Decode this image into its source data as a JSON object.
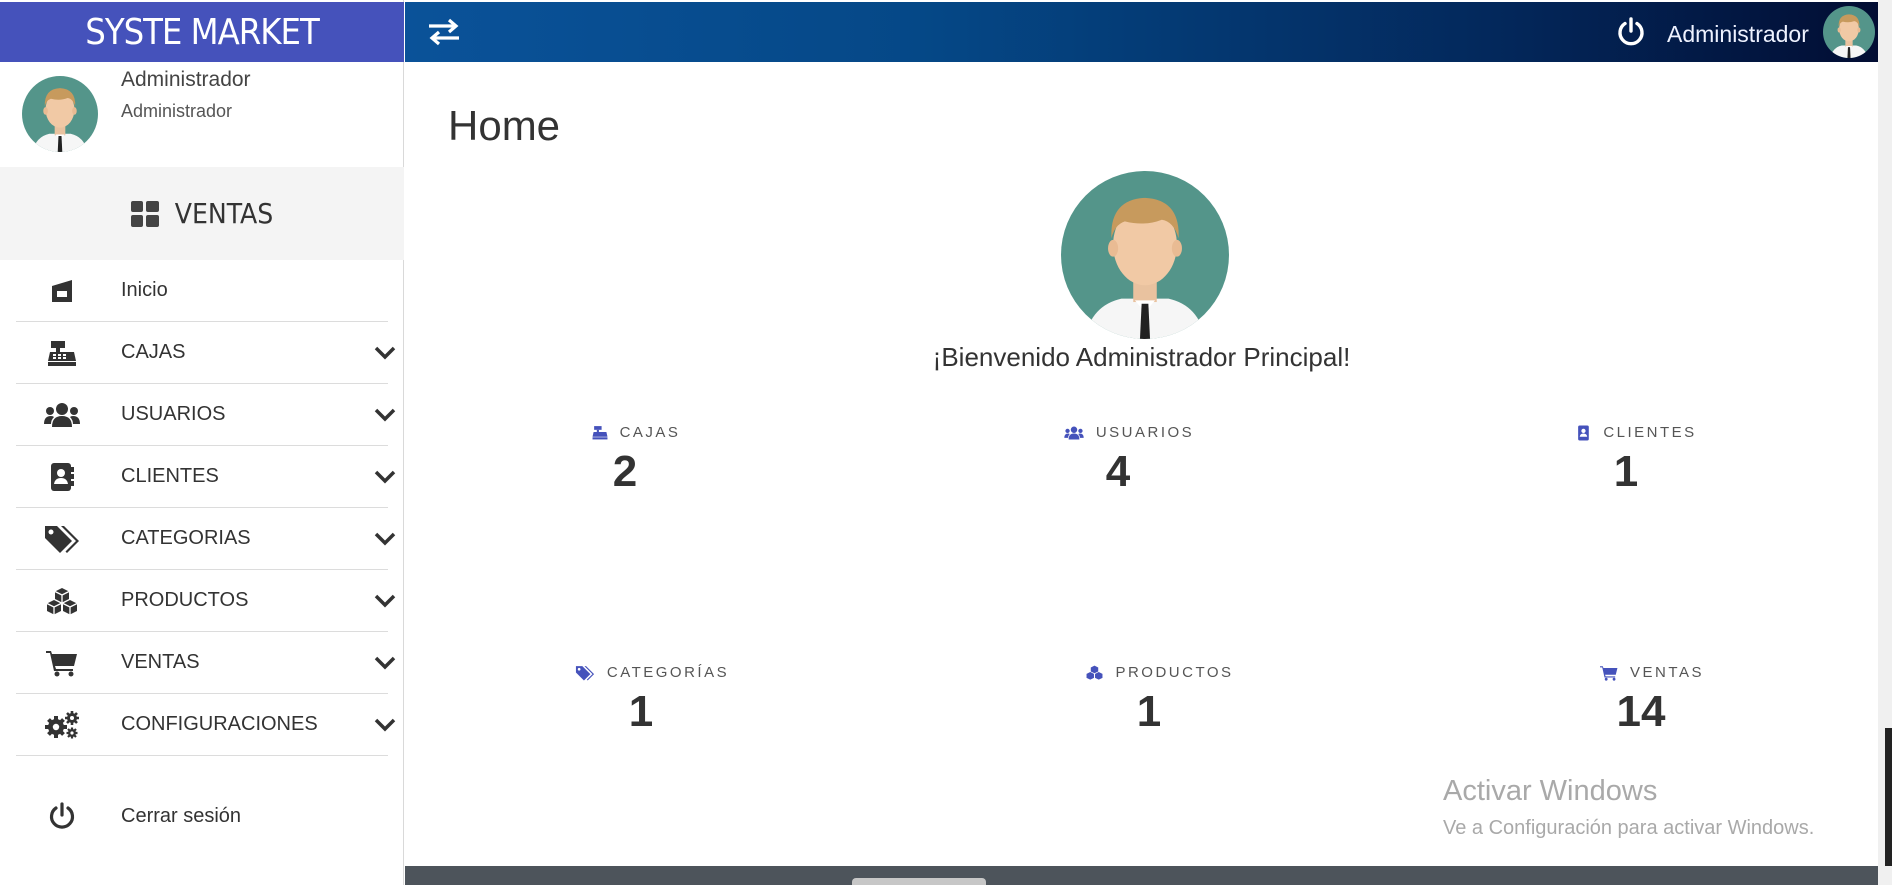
{
  "brand": {
    "title": "SYSTE MARKET",
    "color": "#4552bb"
  },
  "profile": {
    "name": "Administrador",
    "role": "Administrador"
  },
  "sidebar": {
    "section_label": "VENTAS",
    "items": [
      {
        "label": "Inicio",
        "icon": "home-icon",
        "has_chevron": false
      },
      {
        "label": "CAJAS",
        "icon": "cash-register-icon",
        "has_chevron": true
      },
      {
        "label": "USUARIOS",
        "icon": "users-icon",
        "has_chevron": true
      },
      {
        "label": "CLIENTES",
        "icon": "address-book-icon",
        "has_chevron": true
      },
      {
        "label": "CATEGORIAS",
        "icon": "tags-icon",
        "has_chevron": true
      },
      {
        "label": "PRODUCTOS",
        "icon": "cubes-icon",
        "has_chevron": true
      },
      {
        "label": "VENTAS",
        "icon": "cart-icon",
        "has_chevron": true
      },
      {
        "label": "CONFIGURACIONES",
        "icon": "gears-icon",
        "has_chevron": true
      }
    ],
    "logout_label": "Cerrar sesión"
  },
  "topbar": {
    "user_name": "Administrador"
  },
  "main": {
    "title": "Home",
    "welcome": "¡Bienvenido Administrador Principal!",
    "stats": [
      {
        "label": "CAJAS",
        "value": "2",
        "icon": "cash-register-icon"
      },
      {
        "label": "USUARIOS",
        "value": "4",
        "icon": "users-icon"
      },
      {
        "label": "CLIENTES",
        "value": "1",
        "icon": "address-book-icon"
      },
      {
        "label": "CATEGORÍAS",
        "value": "1",
        "icon": "tags-icon"
      },
      {
        "label": "PRODUCTOS",
        "value": "1",
        "icon": "cubes-icon"
      },
      {
        "label": "VENTAS",
        "value": "14",
        "icon": "cart-icon"
      }
    ],
    "stat_icon_color": "#4552bb"
  },
  "watermark": {
    "line1": "Activar Windows",
    "line2": "Ve a Configuración para activar Windows."
  }
}
